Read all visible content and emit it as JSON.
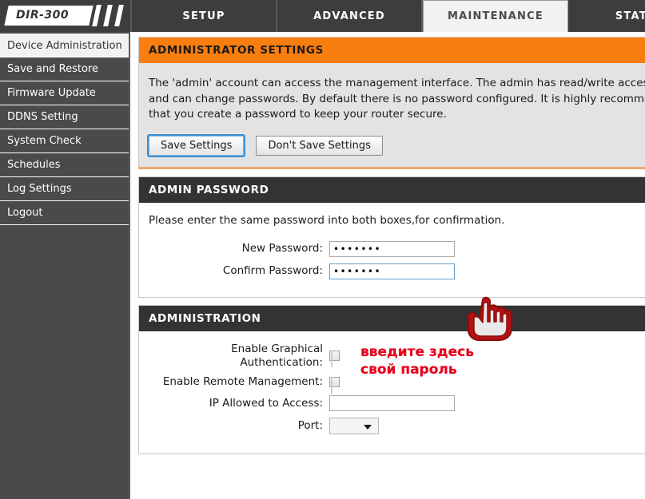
{
  "brand": {
    "model": "DIR-300"
  },
  "topnav": {
    "tabs": [
      {
        "label": "SETUP",
        "active": false
      },
      {
        "label": "ADVANCED",
        "active": false
      },
      {
        "label": "MAINTENANCE",
        "active": true
      },
      {
        "label": "STATUS",
        "active": false
      }
    ]
  },
  "sidebar": {
    "items": [
      {
        "label": "Device Administration",
        "active": true
      },
      {
        "label": "Save and Restore",
        "active": false
      },
      {
        "label": "Firmware Update",
        "active": false
      },
      {
        "label": "DDNS Setting",
        "active": false
      },
      {
        "label": "System Check",
        "active": false
      },
      {
        "label": "Schedules",
        "active": false
      },
      {
        "label": "Log Settings",
        "active": false
      },
      {
        "label": "Logout",
        "active": false
      }
    ]
  },
  "admin_settings": {
    "heading": "ADMINISTRATOR SETTINGS",
    "description_lines": [
      "The 'admin' account can access the management interface. The admin has read/write access",
      "and can change passwords. By default there is no password configured. It is highly recommended",
      "that you create a password to keep your router secure."
    ],
    "save_label": "Save Settings",
    "dont_save_label": "Don't Save Settings"
  },
  "admin_password": {
    "heading": "ADMIN PASSWORD",
    "instruction": "Please enter the same password into both boxes,for confirmation.",
    "new_password_label": "New Password:",
    "new_password_value": "•••••••",
    "confirm_password_label": "Confirm Password:",
    "confirm_password_value": "•••••••"
  },
  "administration": {
    "heading": "ADMINISTRATION",
    "graphical_auth_label_line1": "Enable Graphical",
    "graphical_auth_label_line2": "Authentication:",
    "remote_mgmt_label": "Enable Remote Management:",
    "ip_allowed_label": "IP Allowed to Access:",
    "ip_allowed_value": "",
    "port_label": "Port:",
    "port_value": ""
  },
  "annotation": {
    "line1": "введите здесь",
    "line2": "свой пароль",
    "color": "#e8001c",
    "cursor_icon": "hand-pointer-cursor"
  },
  "colors": {
    "accent_orange": "#f87e0f",
    "header_dark": "#333333",
    "nav_dark": "#3d3d3d",
    "sidebar_dark": "#4a4a4a"
  }
}
